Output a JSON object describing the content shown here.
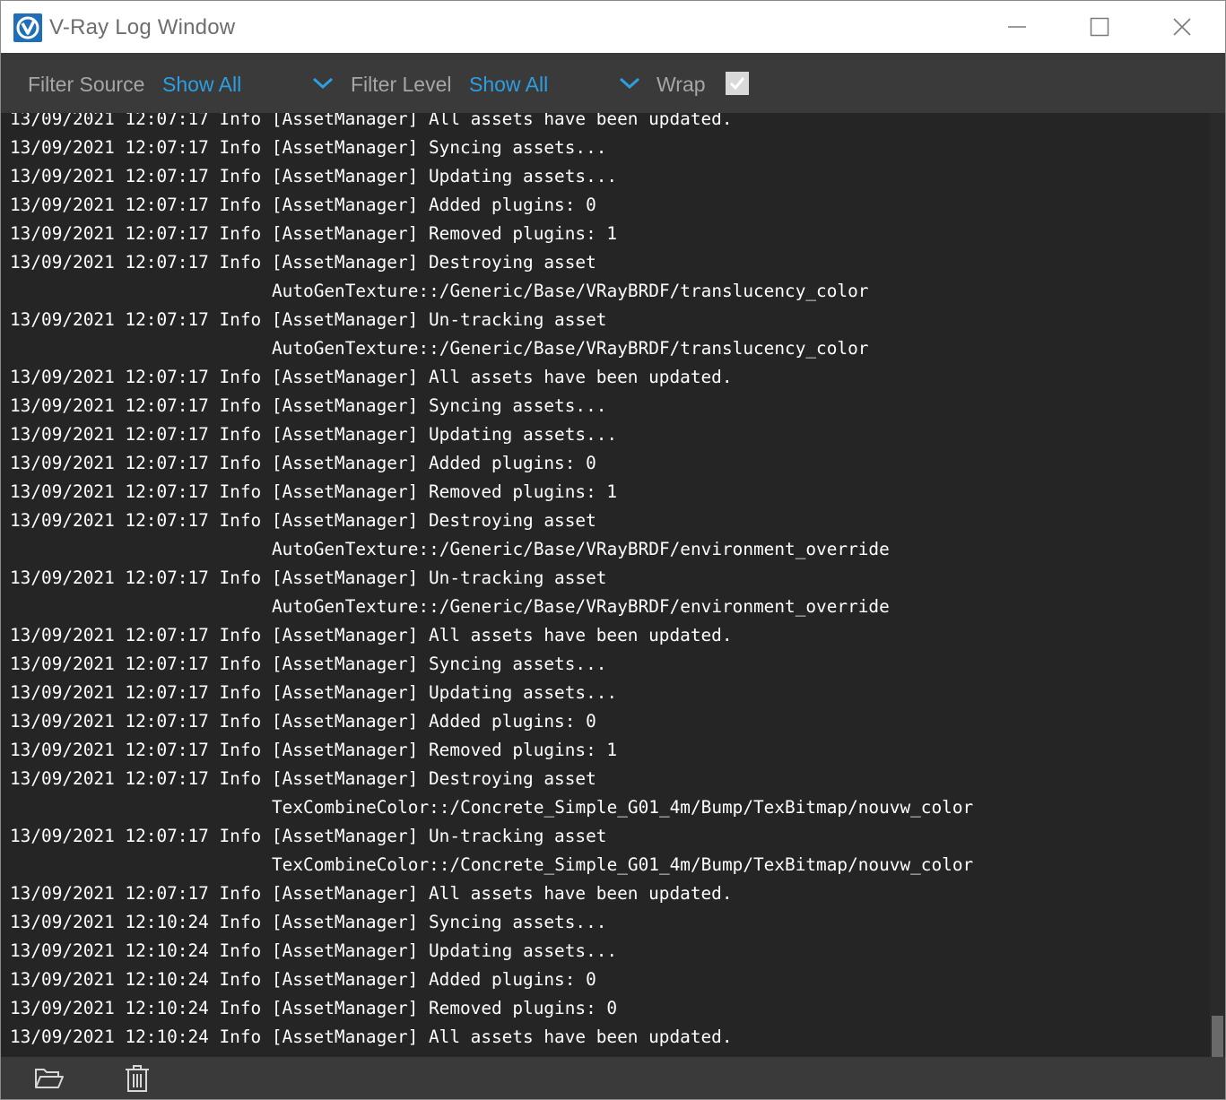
{
  "window": {
    "title": "V-Ray Log Window",
    "icon": "vray-logo-icon"
  },
  "toolbar": {
    "filter_source_label": "Filter Source",
    "filter_source_value": "Show All",
    "filter_level_label": "Filter Level",
    "filter_level_value": "Show All",
    "wrap_label": "Wrap",
    "wrap_checked": true,
    "accent_color": "#2d9ee0"
  },
  "log": {
    "lines": [
      {
        "text": "13/09/2021 12:07:17 Info [AssetManager] All assets have been updated.",
        "cont": false
      },
      {
        "text": "13/09/2021 12:07:17 Info [AssetManager] Syncing assets...",
        "cont": false
      },
      {
        "text": "13/09/2021 12:07:17 Info [AssetManager] Updating assets...",
        "cont": false
      },
      {
        "text": "13/09/2021 12:07:17 Info [AssetManager] Added plugins: 0",
        "cont": false
      },
      {
        "text": "13/09/2021 12:07:17 Info [AssetManager] Removed plugins: 1",
        "cont": false
      },
      {
        "text": "13/09/2021 12:07:17 Info [AssetManager] Destroying asset",
        "cont": false
      },
      {
        "text": "AutoGenTexture::/Generic/Base/VRayBRDF/translucency_color",
        "cont": true
      },
      {
        "text": "13/09/2021 12:07:17 Info [AssetManager] Un-tracking asset",
        "cont": false
      },
      {
        "text": "AutoGenTexture::/Generic/Base/VRayBRDF/translucency_color",
        "cont": true
      },
      {
        "text": "13/09/2021 12:07:17 Info [AssetManager] All assets have been updated.",
        "cont": false
      },
      {
        "text": "13/09/2021 12:07:17 Info [AssetManager] Syncing assets...",
        "cont": false
      },
      {
        "text": "13/09/2021 12:07:17 Info [AssetManager] Updating assets...",
        "cont": false
      },
      {
        "text": "13/09/2021 12:07:17 Info [AssetManager] Added plugins: 0",
        "cont": false
      },
      {
        "text": "13/09/2021 12:07:17 Info [AssetManager] Removed plugins: 1",
        "cont": false
      },
      {
        "text": "13/09/2021 12:07:17 Info [AssetManager] Destroying asset",
        "cont": false
      },
      {
        "text": "AutoGenTexture::/Generic/Base/VRayBRDF/environment_override",
        "cont": true
      },
      {
        "text": "13/09/2021 12:07:17 Info [AssetManager] Un-tracking asset",
        "cont": false
      },
      {
        "text": "AutoGenTexture::/Generic/Base/VRayBRDF/environment_override",
        "cont": true
      },
      {
        "text": "13/09/2021 12:07:17 Info [AssetManager] All assets have been updated.",
        "cont": false
      },
      {
        "text": "13/09/2021 12:07:17 Info [AssetManager] Syncing assets...",
        "cont": false
      },
      {
        "text": "13/09/2021 12:07:17 Info [AssetManager] Updating assets...",
        "cont": false
      },
      {
        "text": "13/09/2021 12:07:17 Info [AssetManager] Added plugins: 0",
        "cont": false
      },
      {
        "text": "13/09/2021 12:07:17 Info [AssetManager] Removed plugins: 1",
        "cont": false
      },
      {
        "text": "13/09/2021 12:07:17 Info [AssetManager] Destroying asset",
        "cont": false
      },
      {
        "text": "TexCombineColor::/Concrete_Simple_G01_4m/Bump/TexBitmap/nouvw_color",
        "cont": true
      },
      {
        "text": "13/09/2021 12:07:17 Info [AssetManager] Un-tracking asset",
        "cont": false
      },
      {
        "text": "TexCombineColor::/Concrete_Simple_G01_4m/Bump/TexBitmap/nouvw_color",
        "cont": true
      },
      {
        "text": "13/09/2021 12:07:17 Info [AssetManager] All assets have been updated.",
        "cont": false
      },
      {
        "text": "13/09/2021 12:10:24 Info [AssetManager] Syncing assets...",
        "cont": false
      },
      {
        "text": "13/09/2021 12:10:24 Info [AssetManager] Updating assets...",
        "cont": false
      },
      {
        "text": "13/09/2021 12:10:24 Info [AssetManager] Added plugins: 0",
        "cont": false
      },
      {
        "text": "13/09/2021 12:10:24 Info [AssetManager] Removed plugins: 0",
        "cont": false
      },
      {
        "text": "13/09/2021 12:10:24 Info [AssetManager] All assets have been updated.",
        "cont": false
      }
    ]
  },
  "footer": {
    "open_icon": "folder-open-icon",
    "clear_icon": "trash-icon"
  }
}
